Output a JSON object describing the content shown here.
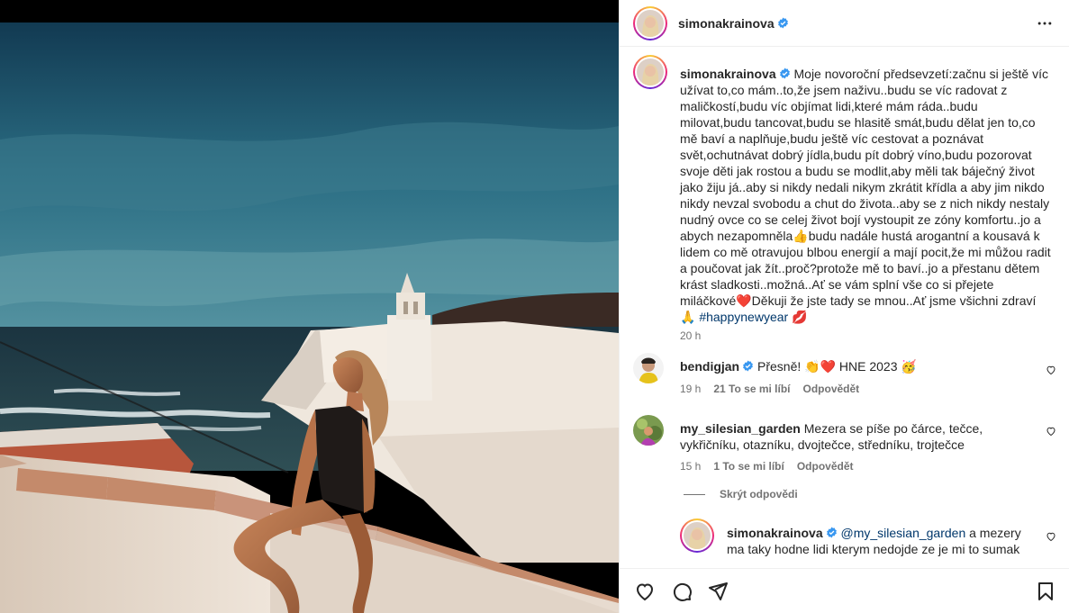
{
  "post": {
    "username": "simonakrainova",
    "verified": true,
    "caption": "Moje novoroční předsevzetí:začnu si ještě víc užívat to,co mám..to,že jsem naživu..budu se víc radovat z maličkostí,budu víc objímat lidi,které mám ráda..budu milovat,budu tancovat,budu se hlasitě smát,budu dělat jen to,co mě baví a naplňuje,budu ještě víc cestovat a poznávat svět,ochutnávat dobrý jídla,budu pít dobrý víno,budu pozorovat svoje děti jak rostou a budu se modlit,aby měli tak báječný život jako žiju já..aby si nikdy nedali nikym zkrátit křídla a aby jim nikdo nikdy nevzal svobodu a chut do života..aby se z nich nikdy nestaly nudný ovce co se celej život bojí vystoupit ze zóny komfortu..jo a abych nezapomněla👍budu nadále hustá arogantní a kousavá k lidem co mě otravujou blbou energií a mají pocit,že mi můžou radit a poučovat jak žít..proč?protože mě to baví..jo a přestanu dětem krást sladkosti..možná..Ať se vám splní vše co si přejete miláčkové❤️Děkuji že jste tady se mnou..Ať jsme všichni zdraví🙏",
    "hashtag": "#happynewyear",
    "caption_end_emoji": "💋",
    "time": "20 h"
  },
  "comments": [
    {
      "username": "bendigjan",
      "verified": true,
      "text": "Přesně! 👏❤️ HNE 2023 🥳",
      "time": "19 h",
      "likes": "21 To se mi líbí",
      "reply_label": "Odpovědět"
    },
    {
      "username": "my_silesian_garden",
      "verified": false,
      "text": "Mezera se píše po čárce, tečce, vykřičníku, otazníku, dvojtečce, středníku, trojtečce",
      "time": "15 h",
      "likes": "1 To se mi líbí",
      "reply_label": "Odpovědět"
    }
  ],
  "hide_replies": "Skrýt odpovědi",
  "reply": {
    "username": "simonakrainova",
    "verified": true,
    "mention": "@my_silesian_garden",
    "text": "a mezery ma taky hodne lidi kterym nedojde ze je mi to sumak"
  },
  "icons": {
    "more": "more-horizontal-icon",
    "like": "heart-icon",
    "comment": "comment-icon",
    "share": "send-icon",
    "save": "bookmark-icon"
  },
  "colors": {
    "link": "#00376b",
    "verified": "#3897f0",
    "muted": "#737373",
    "like_red": "#ed4956"
  }
}
